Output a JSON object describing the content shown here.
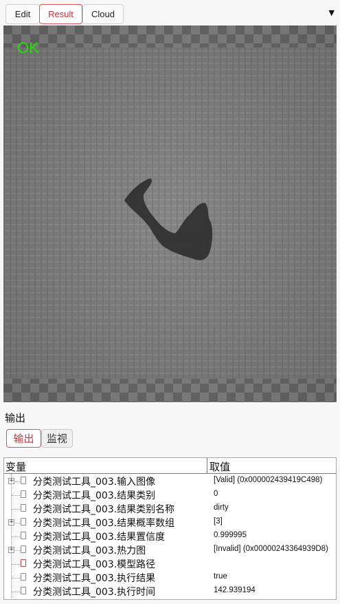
{
  "tabs": [
    {
      "label": "Edit",
      "active": false
    },
    {
      "label": "Result",
      "active": true
    },
    {
      "label": "Cloud",
      "active": false
    }
  ],
  "menu_icon": "caret-down-icon",
  "image_view": {
    "overlay_text": "OK",
    "overlay_color": "#22e000"
  },
  "output": {
    "title": "输出",
    "subtabs": [
      {
        "label": "输出",
        "active": true
      },
      {
        "label": "监视",
        "active": false
      }
    ]
  },
  "table": {
    "col_variable": "变量",
    "col_value": "取值",
    "rows": [
      {
        "name": "分类测试工具_003.输入图像",
        "value": "[Valid] (0x000002439419C498)",
        "expandable": true
      },
      {
        "name": "分类测试工具_003.结果类别",
        "value": "0",
        "expandable": false
      },
      {
        "name": "分类测试工具_003.结果类别名称",
        "value": "dirty",
        "expandable": false
      },
      {
        "name": "分类测试工具_003.结果概率数组",
        "value": "[3]",
        "expandable": true
      },
      {
        "name": "分类测试工具_003.结果置信度",
        "value": "0.999995",
        "expandable": false
      },
      {
        "name": "分类测试工具_003.热力图",
        "value": "[Invalid] (0x00000243364939D8)",
        "expandable": true
      },
      {
        "name": "分类测试工具_003.模型路径",
        "value": "",
        "expandable": false
      },
      {
        "name": "分类测试工具_003.执行结果",
        "value": "true",
        "expandable": false
      },
      {
        "name": "分类测试工具_003.执行时间",
        "value": "142.939194",
        "expandable": false
      }
    ]
  }
}
